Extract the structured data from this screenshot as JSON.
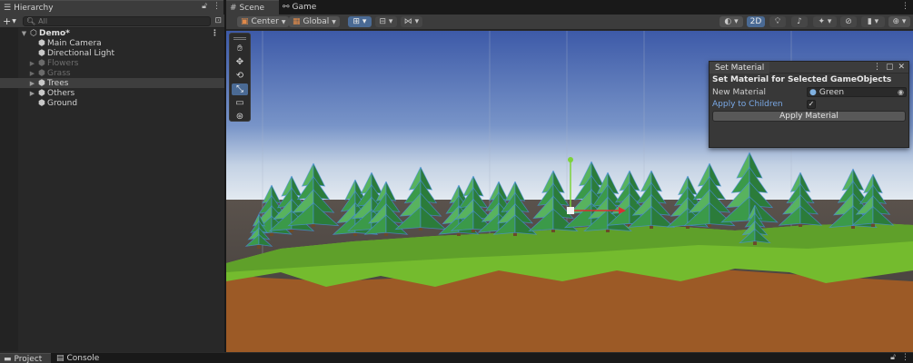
{
  "hierarchy": {
    "tab_label": "Hierarchy",
    "search_placeholder": "All",
    "scene_name": "Demo*",
    "items": [
      {
        "label": "Main Camera"
      },
      {
        "label": "Directional Light"
      },
      {
        "label": "Flowers"
      },
      {
        "label": "Grass"
      },
      {
        "label": "Trees"
      },
      {
        "label": "Others"
      },
      {
        "label": "Ground"
      }
    ]
  },
  "scene_view": {
    "tabs": [
      {
        "label": "Scene"
      },
      {
        "label": "Game"
      }
    ],
    "pivot_mode": "Center",
    "pivot_rotation": "Global",
    "mode_2d": "2D",
    "active_tool": "rect-tool"
  },
  "overlay": {
    "tab_label": "Set Material",
    "title": "Set Material for Selected GameObjects",
    "new_material_label": "New Material",
    "new_material_value": "Green",
    "apply_children_label": "Apply to Children",
    "apply_children_checked": true,
    "apply_button_label": "Apply Material"
  },
  "bottom_bar": {
    "tabs": [
      {
        "label": "Project"
      },
      {
        "label": "Console"
      }
    ]
  },
  "colors": {
    "selection_accent": "#4a6a94",
    "link_blue": "#7aa9e6",
    "tree_green": "#2f8a3f",
    "grass_green": "#7cc234",
    "soil_brown": "#a05a24"
  }
}
